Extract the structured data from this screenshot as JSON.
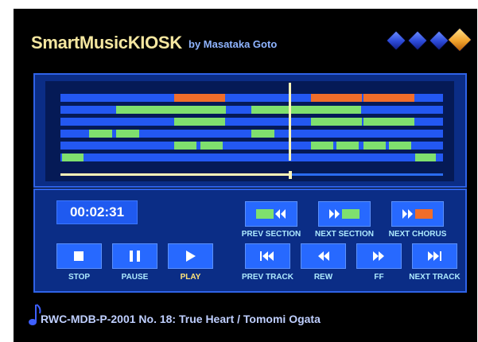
{
  "header": {
    "app_title": "SmartMusicKIOSK",
    "author": "by Masataka Goto"
  },
  "player": {
    "time": "00:02:31",
    "progress_fraction": 0.6
  },
  "buttons": {
    "prev_section": "PREV SECTION",
    "next_section": "NEXT SECTION",
    "next_chorus": "NEXT CHORUS",
    "stop": "STOP",
    "pause": "PAUSE",
    "play": "PLAY",
    "prev_track": "PREV TRACK",
    "rew": "REW",
    "ff": "FF",
    "next_track": "NEXT TRACK"
  },
  "now_playing": {
    "track": "RWC-MDB-P-2001 No. 18: True Heart / Tomomi Ogata"
  },
  "colors": {
    "background": "#000000",
    "panel": "#0b2d86",
    "bar_blue": "#2358f2",
    "section_green": "#7fe06e",
    "chorus_orange": "#f06d2a",
    "playhead": "#fff6b8",
    "title_yellow": "#f5e7a0",
    "active_label": "#ffe47a"
  },
  "icons": {
    "gems": [
      "blue-gem-icon",
      "blue-gem-icon",
      "blue-gem-icon",
      "gold-gem-icon"
    ],
    "note": "music-note-icon"
  }
}
